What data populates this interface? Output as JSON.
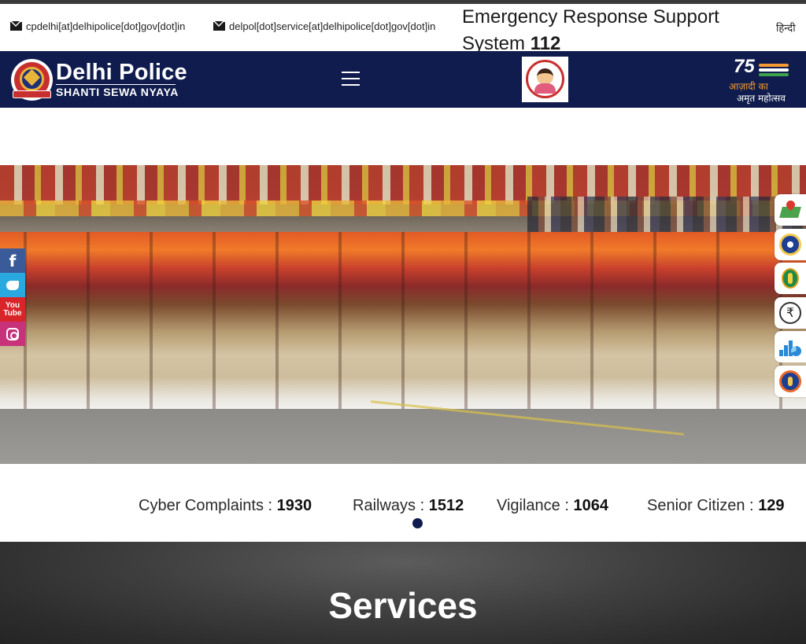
{
  "topbar": {
    "email_1": "cpdelhi[at]delhipolice[dot]gov[dot]in",
    "email_2": "delpol[dot]service[at]delhipolice[dot]gov[dot]in",
    "emergency_label": "Emergency Response Support System",
    "emergency_number": "112",
    "language_toggle": "हिन्दी"
  },
  "header": {
    "brand_name": "Delhi Police",
    "brand_motto": "SHANTI SEWA NYAYA",
    "azadi_number": "75",
    "azadi_line1": "आज़ादी",
    "azadi_ka": "का",
    "azadi_line2": "अमृत महोत्सव"
  },
  "social": {
    "facebook_glyph": "f",
    "youtube_line1": "You",
    "youtube_line2": "Tube"
  },
  "quick_links": {
    "icons": [
      "map-pin-icon",
      "police-seal-icon",
      "traffic-icon",
      "rupee-icon",
      "statistics-icon",
      "emblem-icon"
    ],
    "rupee_glyph": "₹"
  },
  "counters": [
    {
      "label": "Cyber Complaints :",
      "value": "1930"
    },
    {
      "label": "Railways :",
      "value": "1512"
    },
    {
      "label": "Vigilance :",
      "value": "1064"
    },
    {
      "label": "Senior Citizen :",
      "value": "129"
    }
  ],
  "services": {
    "heading": "Services"
  },
  "colors": {
    "navy": "#0f1c4d",
    "facebook": "#3b5a9a",
    "twitter": "#29a9e0",
    "youtube": "#d8252a",
    "instagram": "#c8327a"
  }
}
